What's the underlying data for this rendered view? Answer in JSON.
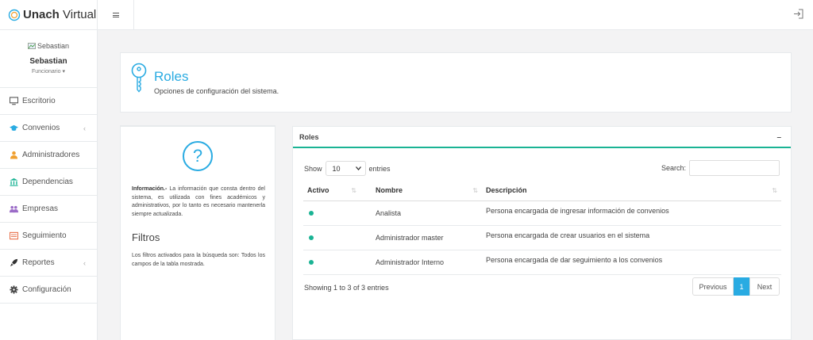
{
  "brand": {
    "bold": "Unach",
    "light": " Virtual"
  },
  "profile": {
    "avatar_alt": "Sebastian",
    "name": "Sebastian",
    "role": "Funcionario ▾"
  },
  "sidebar": {
    "items": [
      {
        "label": "Escritorio",
        "icon": "desktop-icon"
      },
      {
        "label": "Convenios",
        "icon": "graduation-cap-icon",
        "caret": "‹"
      },
      {
        "label": "Administradores",
        "icon": "user-icon"
      },
      {
        "label": "Dependencias",
        "icon": "institution-icon"
      },
      {
        "label": "Empresas",
        "icon": "users-icon"
      },
      {
        "label": "Seguimiento",
        "icon": "list-icon"
      },
      {
        "label": "Reportes",
        "icon": "rocket-icon",
        "caret": "‹"
      },
      {
        "label": "Configuración",
        "icon": "gear-icon"
      }
    ]
  },
  "page": {
    "title": "Roles",
    "subtitle": "Opciones de configuración del sistema."
  },
  "info": {
    "bold": "Información.-",
    "text": " La información que consta dentro del sistema, es utilizada con fines académicos y administrativos, por lo tanto es necesario mantenerla siempre actualizada.",
    "filters_title": "Filtros",
    "filters_text": "Los filtros activados para la búsqueda son: Todos los campos de la tabla mostrada."
  },
  "table_panel": {
    "title": "Roles",
    "collapse": "–",
    "show_label": "Show",
    "entries_value": "10",
    "entries_label": "entries",
    "search_label": "Search:",
    "columns": [
      "Activo",
      "Nombre",
      "Descripción"
    ],
    "rows": [
      {
        "activo": true,
        "nombre": "Analista",
        "descripcion": "Persona encargada de ingresar información de convenios"
      },
      {
        "activo": true,
        "nombre": "Administrador master",
        "descripcion": "Persona encargada de crear usuarios en el sistema"
      },
      {
        "activo": true,
        "nombre": "Administrador Interno",
        "descripcion": "Persona encargada de dar seguimiento a los convenios"
      }
    ],
    "showing": "Showing 1 to 3 of 3 entries",
    "pager": {
      "previous": "Previous",
      "current": "1",
      "next": "Next"
    }
  },
  "colors": {
    "accent": "#29abe2",
    "active": "#1ab394"
  }
}
